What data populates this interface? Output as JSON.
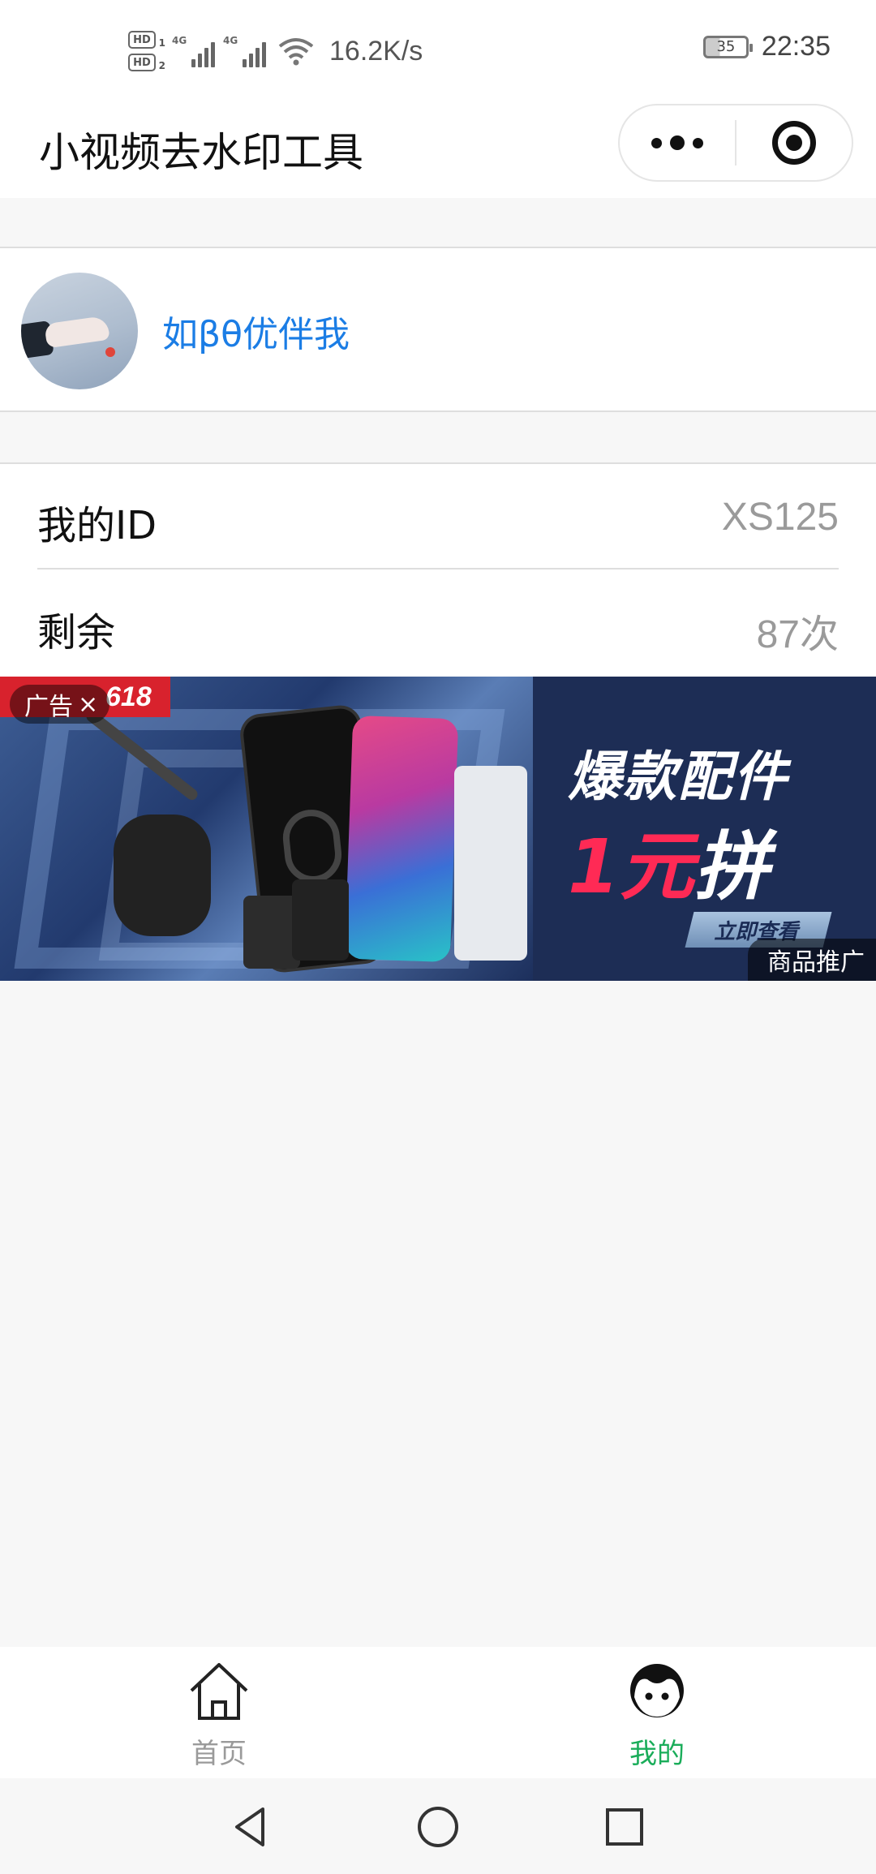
{
  "status_bar": {
    "hd1": "HD",
    "hd1_sub": "1",
    "hd2": "HD",
    "hd2_sub": "2",
    "net1": "4G",
    "net2": "4G",
    "speed": "16.2K/s",
    "battery": "35",
    "time": "22:35",
    "icons": [
      "signal-icon",
      "signal-icon",
      "wifi-icon",
      "battery-icon"
    ]
  },
  "navbar": {
    "title": "小视频去水印工具",
    "menu_icon": "more-icon",
    "close_icon": "target-icon"
  },
  "profile": {
    "nickname": "如βθ优伴我"
  },
  "info": {
    "rows": [
      {
        "label": "我的ID",
        "value": "XS125"
      },
      {
        "label": "剩余",
        "value": "87次"
      }
    ]
  },
  "ad": {
    "tag": "广告",
    "close": "×",
    "badge": "618",
    "headline": "爆款配件",
    "price_red": "1元",
    "price_white": "拼",
    "cta": "立即查看",
    "promo": "商品推广"
  },
  "tabbar": {
    "items": [
      {
        "label": "首页",
        "icon": "home-icon",
        "active": false
      },
      {
        "label": "我的",
        "icon": "face-icon",
        "active": true
      }
    ],
    "active_color": "#1aad5a",
    "inactive_color": "#9a9a9a"
  },
  "colors": {
    "link": "#1b7de5",
    "page_bg": "#f7f7f7"
  }
}
